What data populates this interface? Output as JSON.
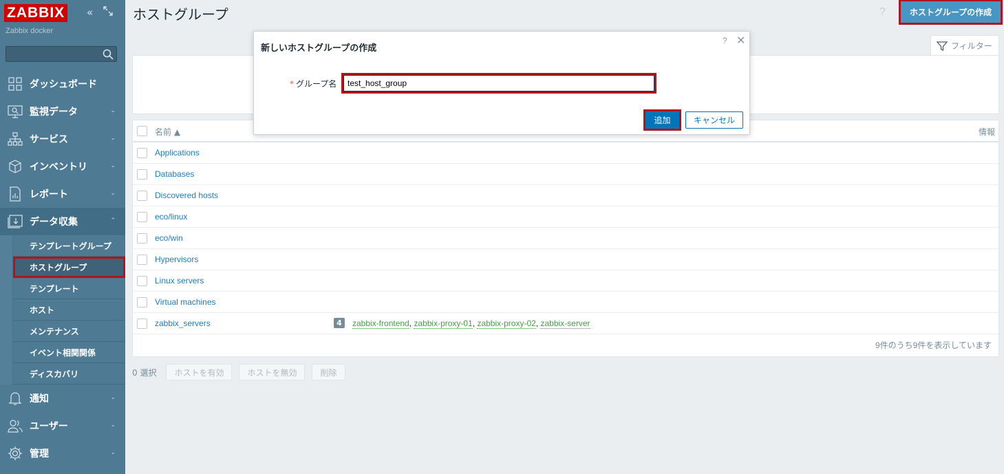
{
  "sidebar": {
    "logo": "ZABBIX",
    "server_name": "Zabbix docker",
    "search": {
      "placeholder": "",
      "value": ""
    },
    "menu": [
      {
        "label": "ダッシュボード",
        "icon": "dashboard-icon"
      },
      {
        "label": "監視データ",
        "icon": "monitoring-icon"
      },
      {
        "label": "サービス",
        "icon": "services-icon"
      },
      {
        "label": "インベントリ",
        "icon": "inventory-icon"
      },
      {
        "label": "レポート",
        "icon": "reports-icon"
      },
      {
        "label": "データ収集",
        "icon": "data-collection-icon"
      }
    ],
    "submenu": [
      "テンプレートグループ",
      "ホストグループ",
      "テンプレート",
      "ホスト",
      "メンテナンス",
      "イベント相関関係",
      "ディスカバリ"
    ],
    "menu_bottom": [
      {
        "label": "通知",
        "icon": "alerts-icon"
      },
      {
        "label": "ユーザー",
        "icon": "users-icon"
      },
      {
        "label": "管理",
        "icon": "administration-icon"
      }
    ]
  },
  "header": {
    "title": "ホストグループ",
    "help": "?",
    "create_button": "ホストグループの作成"
  },
  "filter": {
    "tab_label": "フィルター"
  },
  "table": {
    "col_name": "名前 ▲",
    "col_info": "情報",
    "rows": [
      {
        "name": "Applications"
      },
      {
        "name": "Databases"
      },
      {
        "name": "Discovered hosts"
      },
      {
        "name": "eco/linux"
      },
      {
        "name": "eco/win"
      },
      {
        "name": "Hypervisors"
      },
      {
        "name": "Linux servers"
      },
      {
        "name": "Virtual machines"
      },
      {
        "name": "zabbix_servers",
        "count": "4",
        "hosts": [
          "zabbix-frontend",
          "zabbix-proxy-01",
          "zabbix-proxy-02",
          "zabbix-server"
        ]
      }
    ],
    "footer": "9件のうち9件を表示しています"
  },
  "actions": {
    "selected": "0 選択",
    "enable": "ホストを有効",
    "disable": "ホストを無効",
    "delete": "削除"
  },
  "modal": {
    "title": "新しいホストグループの作成",
    "help": "?",
    "close": "✕",
    "field_label": "グループ名",
    "required_mark": "*",
    "field_value": "test_host_group",
    "add_button": "追加",
    "cancel_button": "キャンセル"
  },
  "colors": {
    "sidebar": "#4f7a94",
    "link": "#1f7bbf",
    "host_link": "#429e47",
    "primary": "#0275b8",
    "highlight": "#b0141c",
    "logo": "#d40000"
  }
}
